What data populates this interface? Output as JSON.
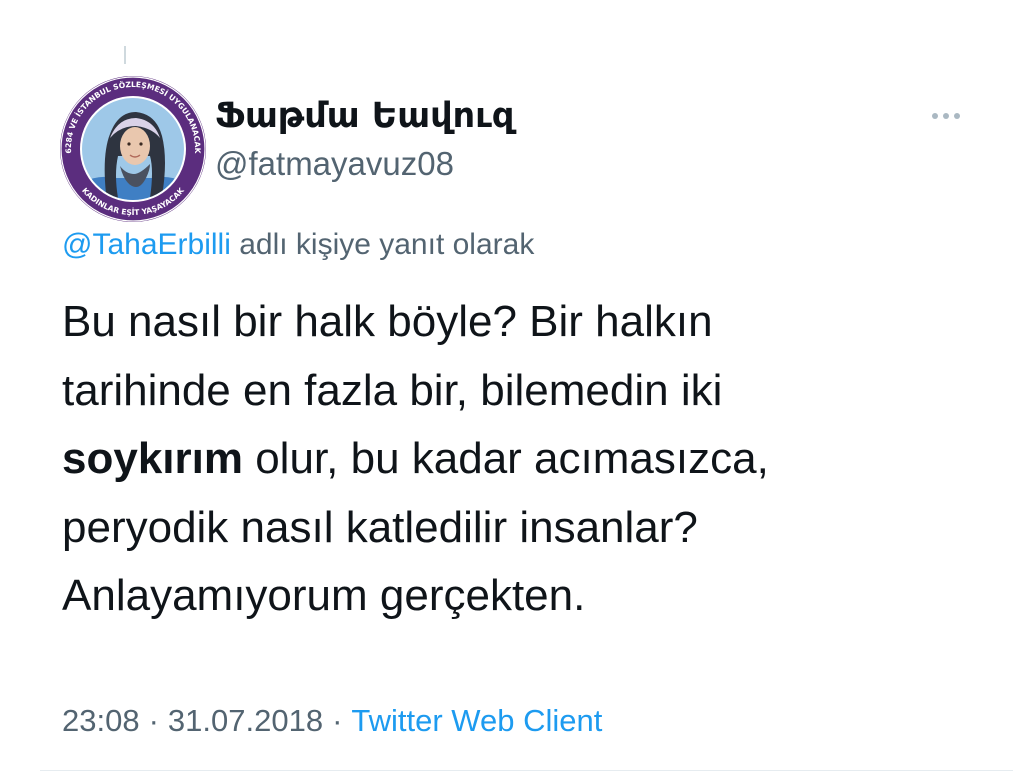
{
  "author": {
    "display_name": "Ֆաթմա Եավուզ",
    "handle": "@fatmayavuz08"
  },
  "avatar": {
    "ring_text_top": "6284 VE İSTANBUL SÖZLEŞMESİ UYGULANACAK",
    "ring_text_bottom": "KADINLAR EŞİT YAŞAYACAK",
    "ring_color": "#5b2d7e"
  },
  "reply": {
    "mention": "@TahaErbilli",
    "suffix": " adlı kişiye yanıt olarak"
  },
  "tweet": {
    "line_1": "Bu nasıl bir halk böyle? Bir halkın",
    "line_2": "tarihinde en fazla bir, bilemedin iki",
    "line_3_bold": "soykırım",
    "line_3_rest": " olur, bu kadar acımasızca,",
    "line_4": "peryodik nasıl katledilir insanlar?",
    "line_5": "Anlayamıyorum gerçekten."
  },
  "footer": {
    "time": "23:08",
    "separator": "·",
    "date": "31.07.2018",
    "source": "Twitter Web Client"
  },
  "icons": {
    "more": "more-horizontal-icon"
  },
  "colors": {
    "text": "#0f1419",
    "secondary": "#536471",
    "link": "#1d9bf0"
  }
}
